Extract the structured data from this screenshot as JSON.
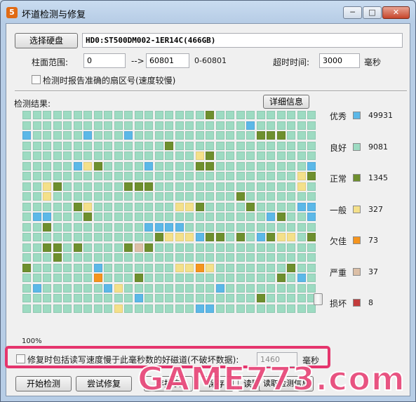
{
  "window": {
    "title": "坏道检测与修复",
    "app_icon_glyph": "5"
  },
  "titlebar": {
    "min_glyph": "─",
    "max_glyph": "□",
    "close_glyph": "✕"
  },
  "disk": {
    "select_label": "选择硬盘",
    "info": "HD0:ST500DM002-1ER14C(466GB)"
  },
  "range": {
    "label": "柱面范围:",
    "start": "0",
    "arrow": "-->",
    "end": "60801",
    "hint": "0-60801",
    "timeout_label": "超时时间:",
    "timeout_value": "3000",
    "timeout_unit": "毫秒"
  },
  "report_option": {
    "label": "检测时报告准确的扇区号(速度较慢)"
  },
  "results": {
    "label": "检测结果:",
    "details_button": "详细信息"
  },
  "legend": [
    {
      "name": "优秀",
      "count": "49931",
      "color": "#5cb8e8"
    },
    {
      "name": "良好",
      "count": "9081",
      "color": "#9ddbc2"
    },
    {
      "name": "正常",
      "count": "1345",
      "color": "#6e8f2e"
    },
    {
      "name": "一般",
      "count": "327",
      "color": "#f4e08a"
    },
    {
      "name": "欠佳",
      "count": "73",
      "color": "#f5941d"
    },
    {
      "name": "严重",
      "count": "37",
      "color": "#dcbfa6"
    },
    {
      "name": "损坏",
      "count": "8",
      "color": "#c33b3b"
    }
  ],
  "progress": {
    "text": "100%",
    "value": 1.0
  },
  "repair_option": {
    "label": "修复时包括读写速度慢于此毫秒数的好磁道(不破坏数据):",
    "value": "1460",
    "unit": "毫秒"
  },
  "actions": {
    "start": "开始检测",
    "try_repair": "尝试修复",
    "save_report_partial": "存报表",
    "save_partial": "保存",
    "load_partial": "读取",
    "load_info_partial": "读取检测信息"
  },
  "watermark": {
    "text": "GAME773.com"
  },
  "map": {
    "cols": 29,
    "rows": 20,
    "cells": [
      "GGGGGGGGGGGGGGGGGGNGGGGGGGGGG",
      "GGGGGGGGGGGGGGGGGGGGGGBGGGGGG",
      "BGGGGGBGGGBGGGGGGGGGGGGNNNGGG",
      "GGGGGGGGGGGGGGNGGGGGGGGGGGGGG",
      "GGGGGGGGGGGGGGGGGYNGGGGGGGGGG",
      "GGGGGBYNGGGGBGGGGNNGGGGGGGGGB",
      "GGGGGGGGGGGGGGGGGGGGGGGGGGGYN",
      "GGYNGGGGGGNNNGGGGGGGGGGGGGGYG",
      "GGYGGGGGGGGGGGGGGGGGGNGGGGGGG",
      "GGGGGNYGGGGGGGGYYNGGGGNGGGGBB",
      "GBBGGGNGGGGGGGGGGGGGGGGGBNGGB",
      "GGNGGGGGGGGGBBBBGGGGGGGGGGGGG",
      "GGGGGGGGGGGGGNYYYBNNGNGBNYYGN",
      "GGNNGNGGGGNTNGGGGGGGGGGGGGGGG",
      "GGGNGGGGGGGGGGGGGGGGGGGGGGGGG",
      "NGGGGGGBGGGGGGGYYOYGGGGGGGNGG",
      "GGGGGGGOGGGNGGGGGGGGGGGGGNGBG",
      "GBGGGGGGBYGGGGGGGGGBGGGGGGGGG",
      "GGGGGGGGGGGBGGGGGGGGGGGNGGGGG",
      "GGGGGGGGGYGGGGGGGBBGGGGGGGGGG"
    ]
  }
}
